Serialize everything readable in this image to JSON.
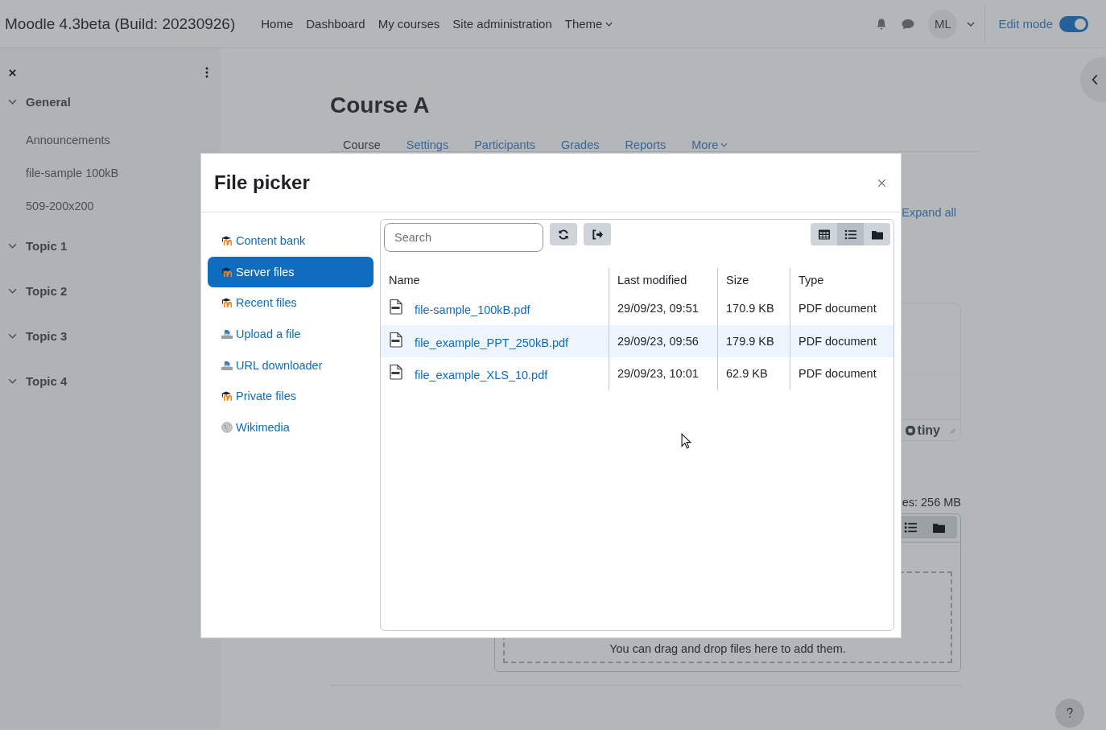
{
  "header": {
    "site_name": "Moodle 4.3beta (Build: 20230926)",
    "nav": [
      {
        "label": "Home",
        "has_menu": false
      },
      {
        "label": "Dashboard",
        "has_menu": false
      },
      {
        "label": "My courses",
        "has_menu": false
      },
      {
        "label": "Site administration",
        "has_menu": false
      },
      {
        "label": "Theme",
        "has_menu": true
      }
    ],
    "user_initials": "ML",
    "edit_mode": {
      "label": "Edit mode",
      "on": true
    }
  },
  "course_index": {
    "sections": [
      {
        "label": "General",
        "expanded": true,
        "children": [
          {
            "label": "Announcements"
          },
          {
            "label": "file-sample 100kB"
          },
          {
            "label": "509-200x200"
          }
        ]
      },
      {
        "label": "Topic 1",
        "expanded": true
      },
      {
        "label": "Topic 2",
        "expanded": true
      },
      {
        "label": "Topic 3",
        "expanded": true
      },
      {
        "label": "Topic 4",
        "expanded": true
      }
    ]
  },
  "course": {
    "title": "Course A",
    "tabs": [
      {
        "label": "Course",
        "selected": true,
        "has_menu": false
      },
      {
        "label": "Settings",
        "selected": false,
        "has_menu": false
      },
      {
        "label": "Participants",
        "selected": false,
        "has_menu": false
      },
      {
        "label": "Grades",
        "selected": false,
        "has_menu": false
      },
      {
        "label": "Reports",
        "selected": false,
        "has_menu": false
      },
      {
        "label": "More",
        "selected": false,
        "has_menu": true
      }
    ],
    "expand_all": "Expand all",
    "editor_brand": "tiny",
    "size_limit": "es: 256 MB",
    "drop_hint": "You can drag and drop files here to add them."
  },
  "file_picker": {
    "title": "File picker",
    "repositories": [
      {
        "label": "Content bank",
        "kind": "moodle",
        "selected": false
      },
      {
        "label": "Server files",
        "kind": "moodle",
        "selected": true
      },
      {
        "label": "Recent files",
        "kind": "moodle",
        "selected": false
      },
      {
        "label": "Upload a file",
        "kind": "upload",
        "selected": false
      },
      {
        "label": "URL downloader",
        "kind": "upload",
        "selected": false
      },
      {
        "label": "Private files",
        "kind": "moodle",
        "selected": false
      },
      {
        "label": "Wikimedia",
        "kind": "wiki",
        "selected": false
      }
    ],
    "search": {
      "placeholder": "Search"
    },
    "view_modes": [
      {
        "kind": "grid",
        "selected": false
      },
      {
        "kind": "list",
        "selected": true
      },
      {
        "kind": "tree",
        "selected": false
      }
    ],
    "table": {
      "columns": [
        "Name",
        "Last modified",
        "Size",
        "Type"
      ],
      "rows": [
        {
          "name": "file-sample_100kB.pdf",
          "modified": "29/09/23, 09:51",
          "size": "170.9 KB",
          "type": "PDF document",
          "selected": false
        },
        {
          "name": "file_example_PPT_250kB.pdf",
          "modified": "29/09/23, 09:56",
          "size": "179.9 KB",
          "type": "PDF document",
          "selected": true
        },
        {
          "name": "file_example_XLS_10.pdf",
          "modified": "29/09/23, 10:01",
          "size": "62.9 KB",
          "type": "PDF document",
          "selected": false
        }
      ]
    }
  }
}
